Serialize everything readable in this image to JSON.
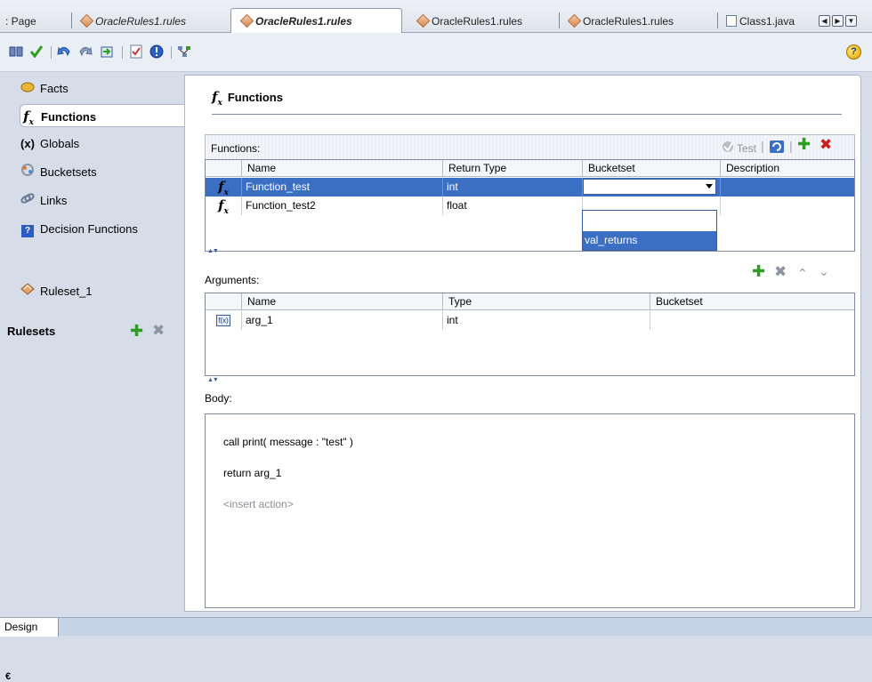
{
  "tabs": [
    {
      "label": ": Page"
    },
    {
      "label": "OracleRules1.rules"
    },
    {
      "label": "OracleRules1.rules"
    },
    {
      "label": "OracleRules1.rules"
    },
    {
      "label": "OracleRules1.rules"
    },
    {
      "label": "Class1.java"
    }
  ],
  "toolbar": {
    "help_label": "?"
  },
  "nav": {
    "facts": "Facts",
    "functions": "Functions",
    "globals": "Globals",
    "buckets": "Bucketsets",
    "links": "Links",
    "decision_functions": "Decision Functions",
    "rulesets_label": "Rulesets",
    "ruleset_item": "Ruleset_1",
    "globals_icon": "(x)",
    "decision_icon": "?"
  },
  "main": {
    "title": "Functions",
    "functions_label": "Functions:",
    "test_label": "Test",
    "functions_columns": [
      "Name",
      "Return Type",
      "Bucketset",
      "Description"
    ],
    "functions_rows": [
      {
        "name": "Function_test",
        "return_type": "int"
      },
      {
        "name": "Function_test2",
        "return_type": "float"
      }
    ],
    "bucket_option": "val_returns",
    "arguments_label": "Arguments:",
    "arguments_columns": [
      "Name",
      "Type",
      "Bucketset"
    ],
    "arguments_rows": [
      {
        "icon": "f(x)",
        "name": "arg_1",
        "type": "int"
      }
    ],
    "body_label": "Body:",
    "body_lines": [
      "call print( message : \"test\" )",
      "return arg_1"
    ],
    "body_placeholder": "<insert action>"
  },
  "bottom": {
    "design_tab": "Design",
    "collapse_icon": "€"
  },
  "colors": {
    "selection": "#3a6fc4",
    "add": "#2f9d24",
    "delete": "#cc2020"
  }
}
